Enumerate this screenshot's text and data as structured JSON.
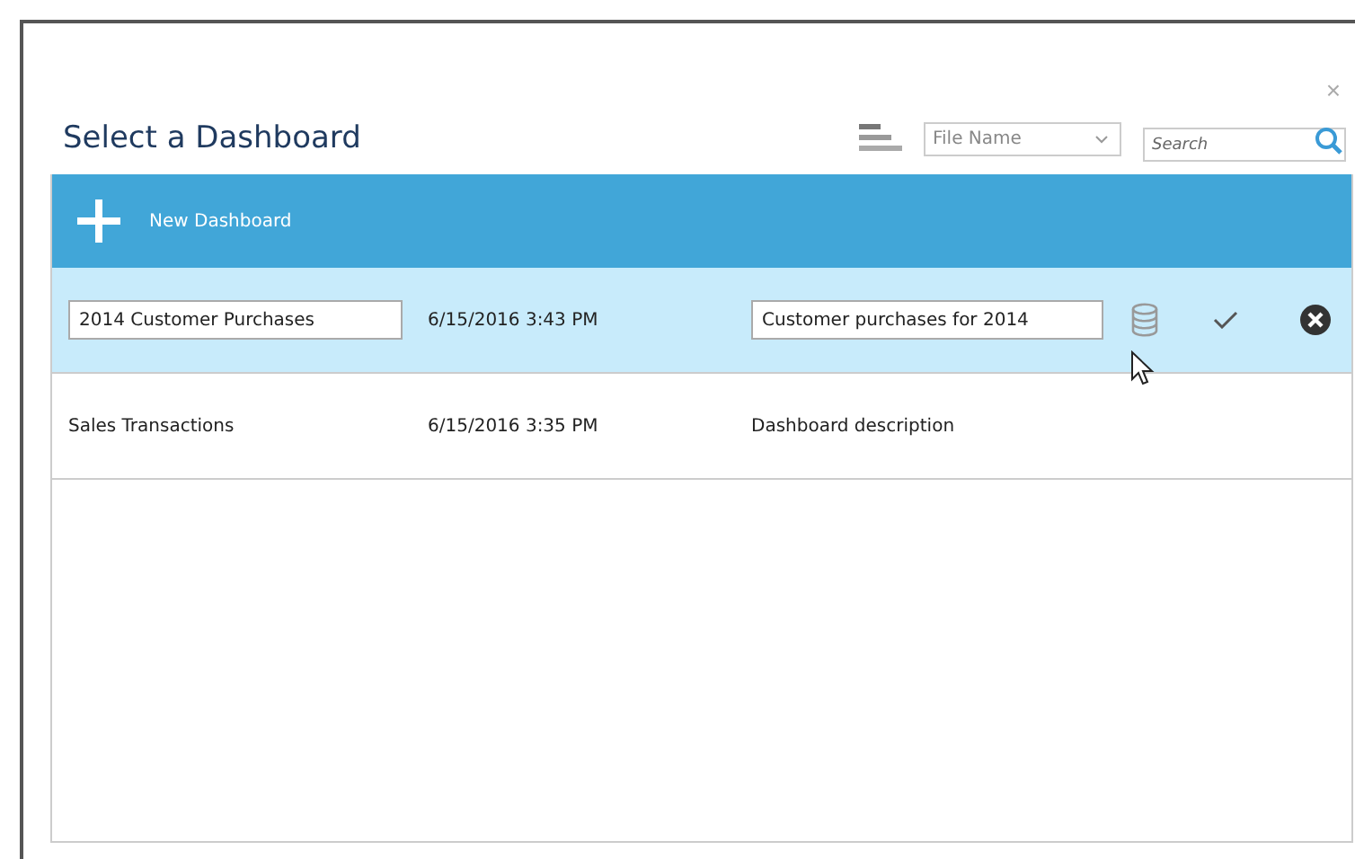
{
  "dialog": {
    "title": "Select a Dashboard",
    "close": "×"
  },
  "toolbar": {
    "sort": {
      "selected": "File Name"
    },
    "search": {
      "placeholder": "Search"
    }
  },
  "new_button": {
    "label": "New Dashboard"
  },
  "rows": [
    {
      "kind": "edit",
      "selected": true,
      "name": "2014 Customer Purchases",
      "date": "6/15/2016 3:43 PM",
      "description": "Customer purchases for 2014"
    },
    {
      "kind": "view",
      "selected": false,
      "name": "Sales Transactions",
      "date": "6/15/2016 3:35 PM",
      "description": "Dashboard description"
    }
  ]
}
